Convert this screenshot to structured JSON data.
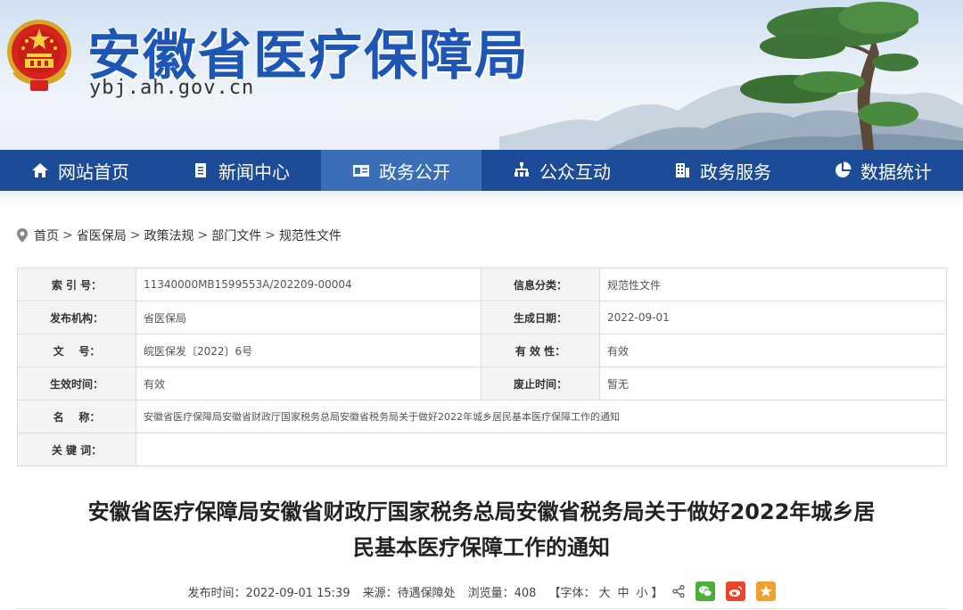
{
  "header": {
    "site_title": "安徽省医疗保障局",
    "site_domain": "ybj.ah.gov.cn"
  },
  "nav": {
    "items": [
      {
        "label": "网站首页",
        "icon": "home-icon"
      },
      {
        "label": "新闻中心",
        "icon": "document-icon"
      },
      {
        "label": "政务公开",
        "icon": "id-card-icon"
      },
      {
        "label": "公众互动",
        "icon": "network-icon"
      },
      {
        "label": "政务服务",
        "icon": "building-icon"
      },
      {
        "label": "数据统计",
        "icon": "pie-chart-icon"
      }
    ],
    "active_index": 2
  },
  "breadcrumb": {
    "items": [
      "首页",
      "省医保局",
      "政策法规",
      "部门文件",
      "规范性文件"
    ],
    "separator": ">"
  },
  "info_table": {
    "index_label": "索 引 号：",
    "index_value": "11340000MB1599553A/202209-00004",
    "category_label": "信息分类：",
    "category_value": "规范性文件",
    "publisher_label": "发布机构：",
    "publisher_value": "省医保局",
    "created_label": "生成日期：",
    "created_value": "2022-09-01",
    "docno_label": "文    号：",
    "docno_value": "皖医保发〔2022〕6号",
    "validity_label": "有 效 性：",
    "validity_value": "有效",
    "effective_label": "生效时间：",
    "effective_value": "有效",
    "expiry_label": "废止时间：",
    "expiry_value": "暂无",
    "name_label": "名    称：",
    "name_value": "安徽省医疗保障局安徽省财政厅国家税务总局安徽省税务局关于做好2022年城乡居民基本医疗保障工作的通知",
    "keywords_label": "关 键 词：",
    "keywords_value": ""
  },
  "article": {
    "title_line1": "安徽省医疗保障局安徽省财政厅国家税务总局安徽省税务局关于做好2022年城乡居",
    "title_line2": "民基本医疗保障工作的通知",
    "publish_time": "发布时间：2022-09-01 15:39",
    "source": "来源：待遇保障处",
    "views": "浏览量：408",
    "font_prefix": "【字体：",
    "font_large": "大",
    "font_medium": "中",
    "font_small": "小",
    "font_suffix": "】"
  },
  "colors": {
    "nav_bg": "#1c4c97",
    "nav_active": "#3a6fb8",
    "title_blue": "#1d56b5",
    "wechat": "#4caf35",
    "weibo": "#e8452c",
    "favorite": "#f0a030"
  }
}
